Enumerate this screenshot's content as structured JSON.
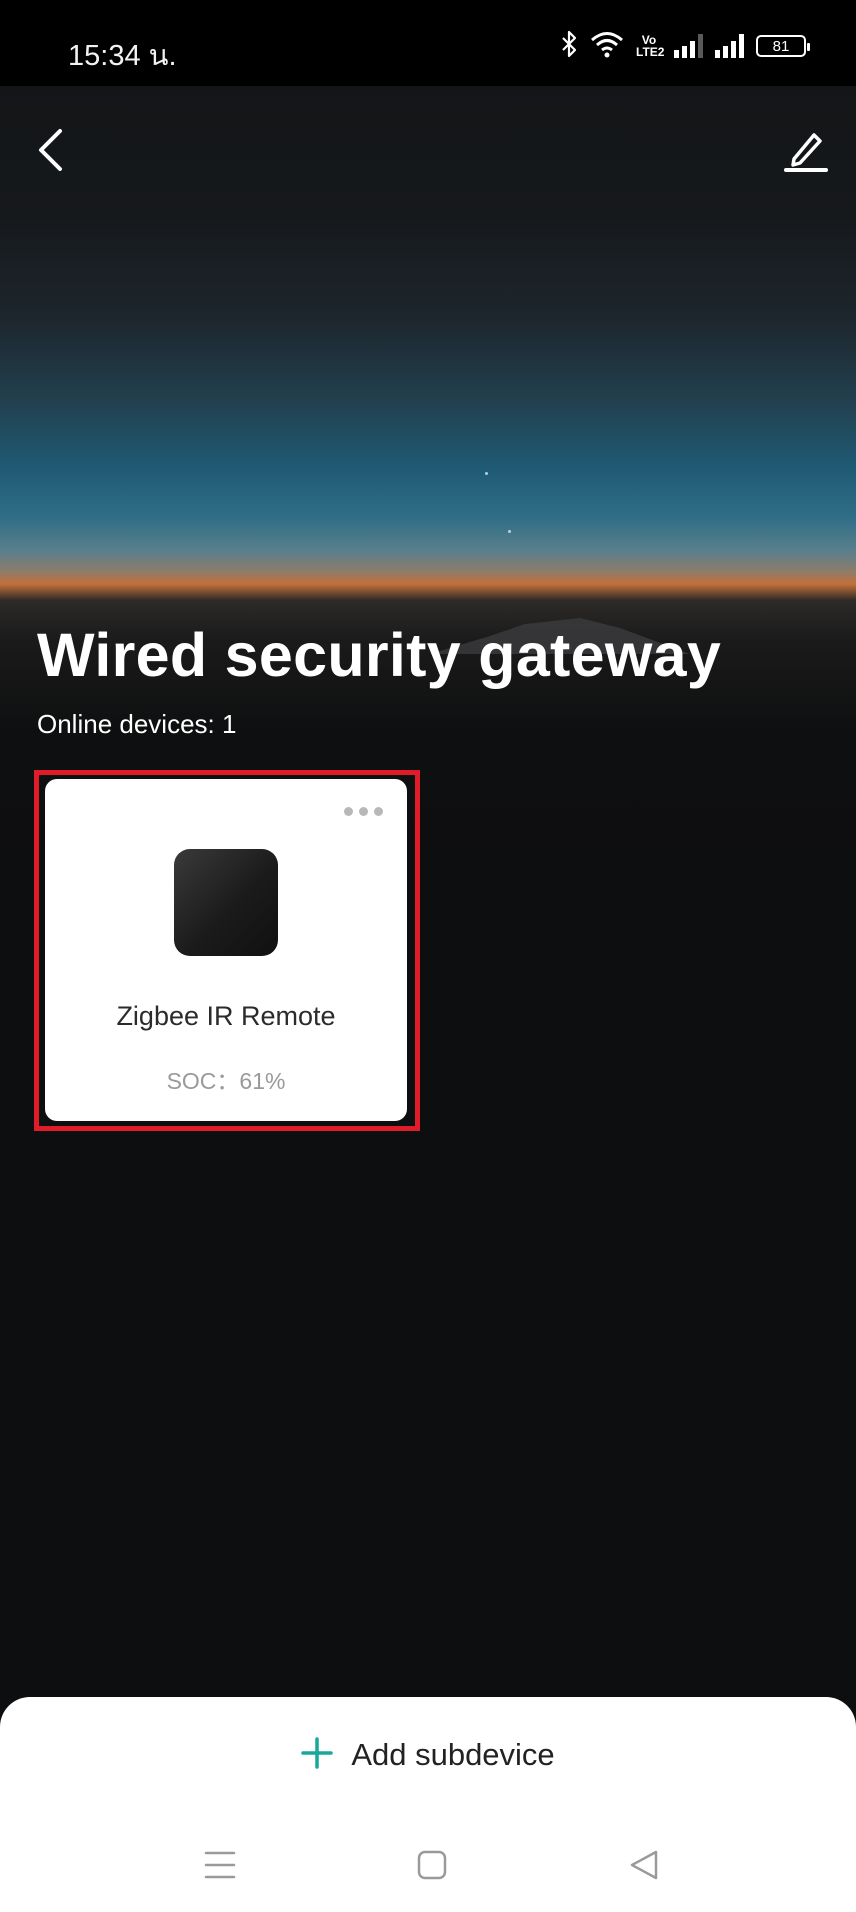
{
  "status_bar": {
    "time": "15:34 น.",
    "volte_label": "Vo LTE2",
    "battery_level": "81",
    "icons": [
      "bluetooth-icon",
      "wifi-icon",
      "volte-icon",
      "signal-icon",
      "signal-icon",
      "battery-icon"
    ]
  },
  "header": {
    "back_icon": "chevron-left-icon",
    "edit_icon": "pencil-icon"
  },
  "gateway": {
    "title": "Wired security gateway",
    "online_label": "Online devices: 1"
  },
  "devices": [
    {
      "name": "Zigbee IR Remote",
      "soc": "SOC：61%",
      "more_icon": "more-horizontal-icon"
    }
  ],
  "highlight_color": "#e01b2a",
  "accent_color": "#16a99a",
  "bottom_sheet": {
    "add_label": "Add subdevice",
    "add_icon": "plus-icon"
  },
  "nav_bar": {
    "icons": [
      "menu-icon",
      "home-square-icon",
      "back-triangle-icon"
    ]
  }
}
